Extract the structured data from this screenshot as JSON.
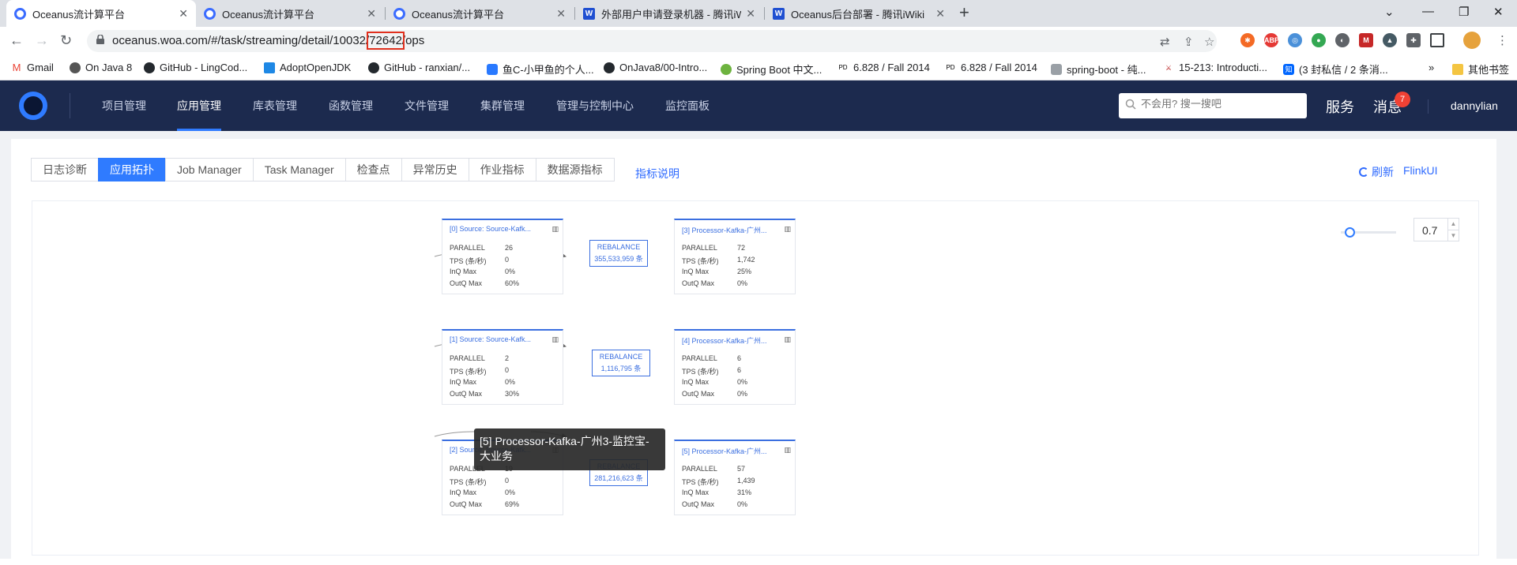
{
  "browser": {
    "tabs": [
      {
        "title": "Oceanus流计算平台",
        "icon": "oceanus"
      },
      {
        "title": "Oceanus流计算平台",
        "icon": "oceanus"
      },
      {
        "title": "Oceanus流计算平台",
        "icon": "oceanus"
      },
      {
        "title": "外部用户申请登录机器 - 腾讯iW",
        "icon": "wiki"
      },
      {
        "title": "Oceanus后台部署 - 腾讯iWiki",
        "icon": "wiki"
      }
    ],
    "url_prefix": "oceanus.woa.com/#/task/streaming/detail/10032/",
    "url_highlight": "72642",
    "url_suffix": "/ops",
    "bookmarks": [
      "Gmail",
      "On Java 8",
      "GitHub - LingCod...",
      "AdoptOpenJDK",
      "GitHub - ranxian/...",
      "鱼C-小甲鱼的个人...",
      "OnJava8/00-Intro...",
      "Spring Boot 中文...",
      "6.828 / Fall 2014",
      "6.828 / Fall 2014",
      "spring-boot - 纯...",
      "15-213: Introducti...",
      "(3 封私信 / 2 条消...",
      "其他书签"
    ]
  },
  "header": {
    "nav": [
      "项目管理",
      "应用管理",
      "库表管理",
      "函数管理",
      "文件管理",
      "集群管理",
      "管理与控制中心",
      "监控面板"
    ],
    "active_nav": "应用管理",
    "search_placeholder": "不会用? 搜一搜吧",
    "service": "服务",
    "messages": "消息",
    "message_count": "7",
    "user": "dannylian"
  },
  "subtabs": [
    "日志诊断",
    "应用拓扑",
    "Job Manager",
    "Task Manager",
    "检查点",
    "异常历史",
    "作业指标",
    "数据源指标"
  ],
  "active_subtab": "应用拓扑",
  "metrics_help": "指标说明",
  "refresh": "刷新",
  "flinkui": "FlinkUI",
  "zoom": "0.7",
  "row_labels": [
    "PARALLEL",
    "TPS (条/秒)",
    "InQ Max",
    "OutQ Max"
  ],
  "nodes": [
    {
      "title": "[0] Source: Source-Kafk...",
      "values": [
        "26",
        "0",
        "0%",
        "60%"
      ]
    },
    {
      "title": "[3] Processor-Kafka-广州...",
      "values": [
        "72",
        "1,742",
        "25%",
        "0%"
      ]
    },
    {
      "title": "[1] Source: Source-Kafk...",
      "values": [
        "2",
        "0",
        "0%",
        "30%"
      ]
    },
    {
      "title": "[4] Processor-Kafka-广州...",
      "values": [
        "6",
        "6",
        "0%",
        "0%"
      ]
    },
    {
      "title": "[2] Source: Source-Kafk...",
      "values": [
        "19",
        "0",
        "0%",
        "69%"
      ]
    },
    {
      "title": "[5] Processor-Kafka-广州...",
      "values": [
        "57",
        "1,439",
        "31%",
        "0%"
      ]
    }
  ],
  "edges": [
    {
      "type": "REBALANCE",
      "count": "355,533,959 条"
    },
    {
      "type": "REBALANCE",
      "count": "1,116,795 条"
    },
    {
      "type": "REBALANCE",
      "count": "281,216,623 条"
    }
  ],
  "tooltip": "[5] Processor-Kafka-广州3-监控宝-大业务"
}
